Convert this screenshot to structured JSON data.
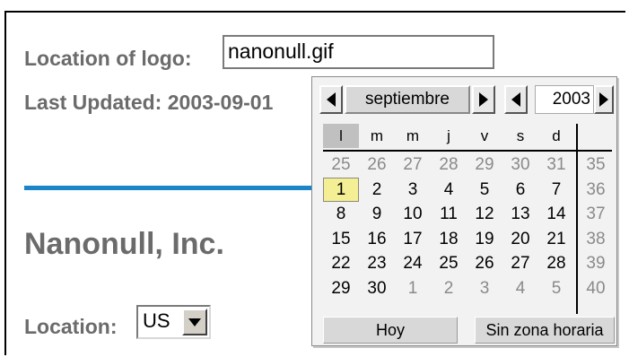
{
  "form": {
    "logo_label": "Location of logo:",
    "logo_value": "nanonull.gif",
    "updated_label": "Last Updated: 2003-09-01",
    "company_name": "Nanonull, Inc.",
    "location_label": "Location:",
    "location_value": "US"
  },
  "calendar": {
    "month": "septiembre",
    "year": "2003",
    "weekdays": [
      "l",
      "m",
      "m",
      "j",
      "v",
      "s",
      "d"
    ],
    "weeks": [
      {
        "days": [
          "25",
          "26",
          "27",
          "28",
          "29",
          "30",
          "31"
        ],
        "week": "35",
        "other": [
          true,
          true,
          true,
          true,
          true,
          true,
          true
        ]
      },
      {
        "days": [
          "1",
          "2",
          "3",
          "4",
          "5",
          "6",
          "7"
        ],
        "week": "36",
        "other": [
          false,
          false,
          false,
          false,
          false,
          false,
          false
        ]
      },
      {
        "days": [
          "8",
          "9",
          "10",
          "11",
          "12",
          "13",
          "14"
        ],
        "week": "37",
        "other": [
          false,
          false,
          false,
          false,
          false,
          false,
          false
        ]
      },
      {
        "days": [
          "15",
          "16",
          "17",
          "18",
          "19",
          "20",
          "21"
        ],
        "week": "38",
        "other": [
          false,
          false,
          false,
          false,
          false,
          false,
          false
        ]
      },
      {
        "days": [
          "22",
          "23",
          "24",
          "25",
          "26",
          "27",
          "28"
        ],
        "week": "39",
        "other": [
          false,
          false,
          false,
          false,
          false,
          false,
          false
        ]
      },
      {
        "days": [
          "29",
          "30",
          "1",
          "2",
          "3",
          "4",
          "5"
        ],
        "week": "40",
        "other": [
          false,
          false,
          true,
          true,
          true,
          true,
          true
        ]
      }
    ],
    "selected_day": "1",
    "today_button": "Hoy",
    "no_timezone_button": "Sin zona horaria"
  },
  "colors": {
    "divider": "#1a86c7",
    "label": "#6b6b6b",
    "selected_day_bg": "#f4ee94"
  }
}
